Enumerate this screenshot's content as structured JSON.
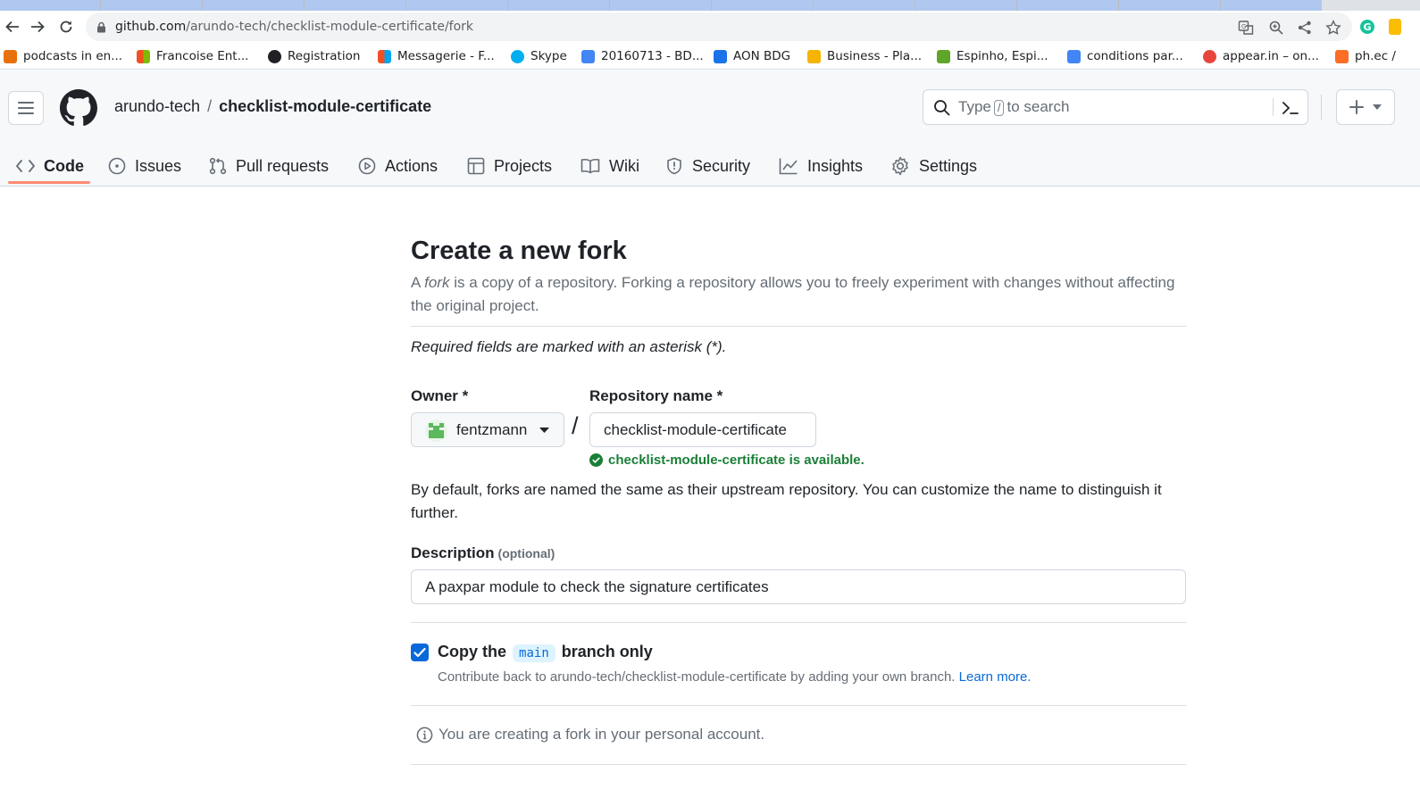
{
  "browser": {
    "url_host": "github.com",
    "url_path": "/arundo-tech/checklist-module-certificate/fork",
    "bookmarks": [
      {
        "label": "podcasts in en...",
        "color": "#e8710a"
      },
      {
        "label": "Francoise Ent...",
        "color": "#f25022"
      },
      {
        "label": "Registration",
        "color": "#202124"
      },
      {
        "label": "Messagerie - F...",
        "color": "#7fba00"
      },
      {
        "label": "Skype",
        "color": "#00aff0"
      },
      {
        "label": "20160713 - BD...",
        "color": "#4285f4"
      },
      {
        "label": "AON BDG",
        "color": "#1a73e8"
      },
      {
        "label": "Business - Pla...",
        "color": "#f4b400"
      },
      {
        "label": "Espinho, Espi...",
        "color": "#5fa52a"
      },
      {
        "label": "conditions par...",
        "color": "#4285f4"
      },
      {
        "label": "appear.in – on...",
        "color": "#e8453c"
      },
      {
        "label": "ph.ec /",
        "color": "#fc6d26"
      }
    ]
  },
  "header": {
    "owner": "arundo-tech",
    "separator": "/",
    "repo": "checklist-module-certificate",
    "search_prefix": "Type",
    "search_key": "/",
    "search_suffix": "to search"
  },
  "nav": {
    "tabs": [
      {
        "label": "Code",
        "icon": "code-icon"
      },
      {
        "label": "Issues",
        "icon": "issue-opened-icon"
      },
      {
        "label": "Pull requests",
        "icon": "git-pull-request-icon"
      },
      {
        "label": "Actions",
        "icon": "play-icon"
      },
      {
        "label": "Projects",
        "icon": "table-icon"
      },
      {
        "label": "Wiki",
        "icon": "book-icon"
      },
      {
        "label": "Security",
        "icon": "shield-icon"
      },
      {
        "label": "Insights",
        "icon": "graph-icon"
      },
      {
        "label": "Settings",
        "icon": "gear-icon"
      }
    ],
    "selected": "Code"
  },
  "form": {
    "title": "Create a new fork",
    "lead_a": "A ",
    "lead_fork": "fork",
    "lead_b": " is a copy of a repository. Forking a repository allows you to freely experiment with changes without affecting the original project.",
    "required_note": "Required fields are marked with an asterisk (*).",
    "owner_label": "Owner *",
    "owner_value": "fentzmann",
    "slash": "/",
    "repo_label": "Repository name *",
    "repo_value": "checklist-module-certificate",
    "availability": "checklist-module-certificate is available.",
    "naming_help": "By default, forks are named the same as their upstream repository. You can customize the name to distinguish it further.",
    "description_label": "Description",
    "description_optional": "(optional)",
    "description_value": "A paxpar module to check the signature certificates",
    "copy_prefix": "Copy the",
    "copy_branch": "main",
    "copy_suffix": "branch only",
    "copy_checked": true,
    "copy_help": "Contribute back to arundo-tech/checklist-module-certificate by adding your own branch.",
    "learn_more": "Learn more.",
    "account_notice": "You are creating a fork in your personal account."
  },
  "colors": {
    "accent_blue": "#0969da",
    "success_green": "#1a7f37",
    "tab_underline": "#fd8c73"
  }
}
